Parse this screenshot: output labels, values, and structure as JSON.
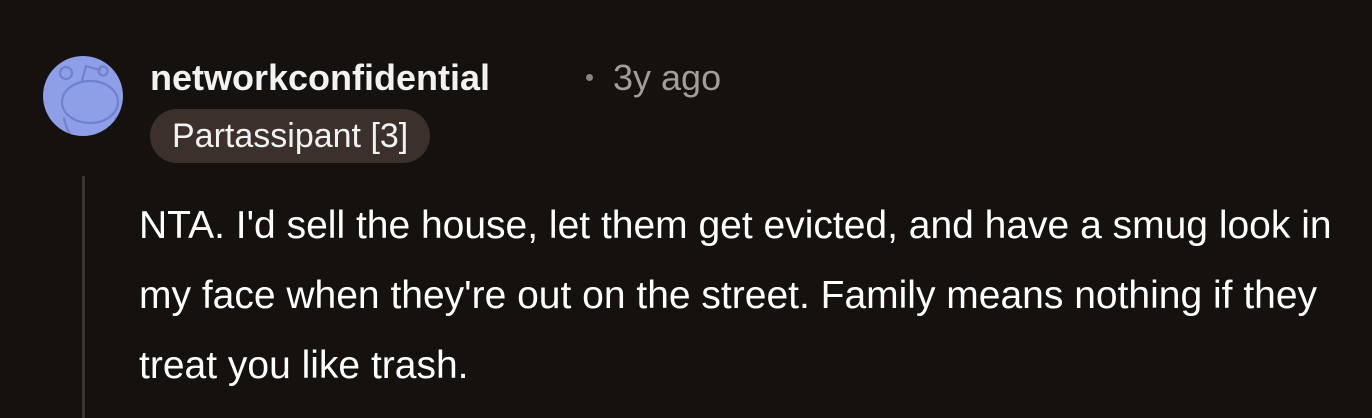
{
  "comment": {
    "username": "networkconfidential",
    "timestamp": "3y ago",
    "flair": "Partassipant [3]",
    "body": "NTA. I'd sell the house, let them get evicted, and have a smug look in my face when they're out on the street. Family means nothing if they treat you like trash."
  },
  "colors": {
    "background": "#14110f",
    "avatar": "#8e9fe7",
    "flair_background": "#3b302b",
    "timestamp": "#a39c97"
  },
  "icons": {
    "avatar": "snoo-avatar-icon",
    "separator": "dot-separator-icon"
  }
}
